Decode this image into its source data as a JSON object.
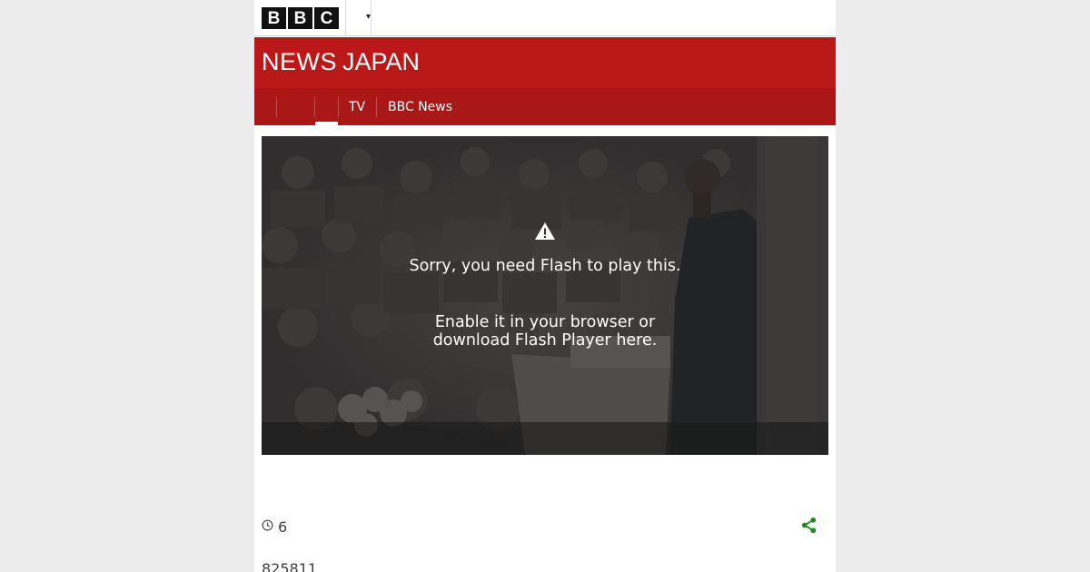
{
  "header": {
    "logo_letters": [
      "B",
      "B",
      "C"
    ],
    "menu_icon": "chevron-down-icon"
  },
  "masthead": {
    "brand_news": "NEWS",
    "brand_region": "JAPAN",
    "color": "#bb1919"
  },
  "nav": {
    "items": [
      {
        "label": "TV"
      },
      {
        "label": "BBC News"
      }
    ],
    "color": "#a91717"
  },
  "player": {
    "warning_icon": "warning-icon",
    "message_primary": "Sorry, you need Flash to play this.",
    "message_secondary": "Enable it in your browser or download Flash Player here."
  },
  "meta": {
    "clock_icon": "clock-icon",
    "count": "6",
    "share_icon": "share-icon",
    "share_color": "#1f8a1f",
    "views": "825811"
  }
}
